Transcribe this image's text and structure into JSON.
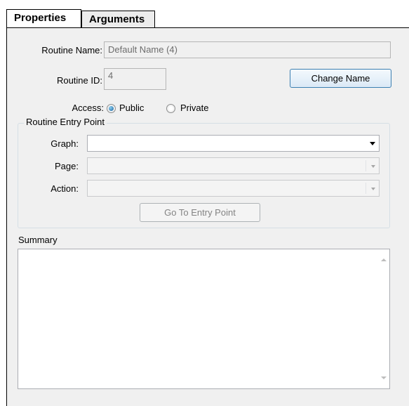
{
  "tabs": [
    {
      "label": "Properties",
      "active": true
    },
    {
      "label": "Arguments",
      "active": false
    }
  ],
  "routine": {
    "name_label": "Routine Name:",
    "name_value": "Default Name (4)",
    "id_label": "Routine ID:",
    "id_value": "4",
    "change_name_label": "Change Name",
    "access_label": "Access:",
    "access_options": [
      {
        "label": "Public",
        "selected": true
      },
      {
        "label": "Private",
        "selected": false
      }
    ]
  },
  "entry_point": {
    "group_title": "Routine Entry Point",
    "graph_label": "Graph:",
    "graph_value": "",
    "page_label": "Page:",
    "page_value": "",
    "action_label": "Action:",
    "action_value": "",
    "goto_label": "Go To Entry Point"
  },
  "summary": {
    "label": "Summary",
    "value": ""
  },
  "colors": {
    "panel_bg": "#f0f0f0",
    "button_border_focus": "#3c7fb1",
    "radio_selected": "#1c5f9a"
  }
}
